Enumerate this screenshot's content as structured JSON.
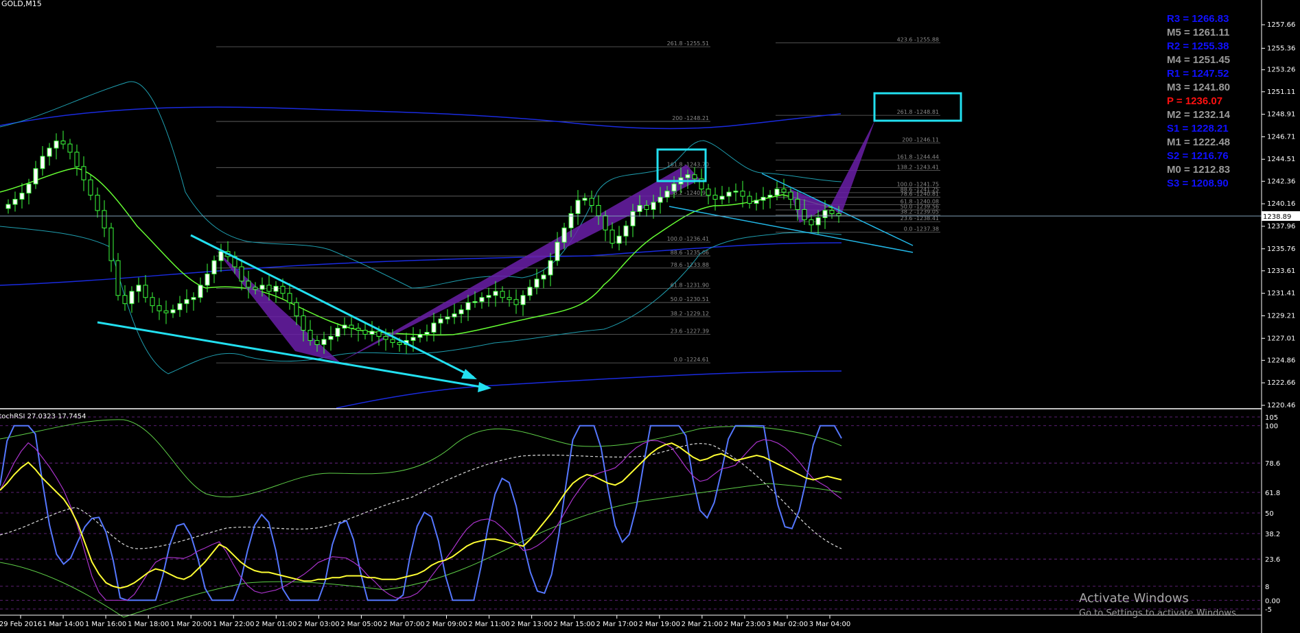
{
  "window": {
    "symbol": "GOLD,M15"
  },
  "indicator": {
    "label": "StochRSI 27.0323 17.7454"
  },
  "watermark": {
    "line1": "Activate Windows",
    "line2": "Go to Settings to activate Windows."
  },
  "colors": {
    "background": "#000000",
    "candle_up": "#ffffff",
    "candle_wick": "#3dff3d",
    "ma_green": "#66ff33",
    "bb_band": "#22b8c8",
    "blue_band": "#1a2be0",
    "pattern": "#6a1fa8",
    "trendline": "#22e0f0",
    "stoch_yellow": "#ffff33",
    "stoch_blue": "#5577ff",
    "stoch_magenta": "#aa33cc",
    "pivot_r": "#1010ff",
    "pivot_m": "#9a9a9a",
    "pivot_p": "#ff1010",
    "pivot_s": "#1010ff"
  },
  "pivots": [
    {
      "name": "R3",
      "text": "R3 = 1266.83",
      "color": "#1010ff"
    },
    {
      "name": "M5",
      "text": "M5 = 1261.11",
      "color": "#9a9a9a"
    },
    {
      "name": "R2",
      "text": "R2 = 1255.38",
      "color": "#1010ff"
    },
    {
      "name": "M4",
      "text": "M4 = 1251.45",
      "color": "#9a9a9a"
    },
    {
      "name": "R1",
      "text": "R1 = 1247.52",
      "color": "#1010ff"
    },
    {
      "name": "M3",
      "text": "M3 = 1241.80",
      "color": "#9a9a9a"
    },
    {
      "name": "P",
      "text": "P   = 1236.07",
      "color": "#ff1010"
    },
    {
      "name": "M2",
      "text": "M2 = 1232.14",
      "color": "#9a9a9a"
    },
    {
      "name": "S1",
      "text": "S1 = 1228.21",
      "color": "#1010ff"
    },
    {
      "name": "M1",
      "text": "M1 = 1222.48",
      "color": "#9a9a9a"
    },
    {
      "name": "S2",
      "text": "S2 = 1216.76",
      "color": "#1010ff"
    },
    {
      "name": "M0",
      "text": "M0 = 1212.83",
      "color": "#9a9a9a"
    },
    {
      "name": "S3",
      "text": "S3 = 1208.90",
      "color": "#1010ff"
    }
  ],
  "chart_data": [
    {
      "type": "line",
      "name": "price",
      "ylim": [
        1220.46,
        1259.81
      ],
      "yticks": [
        "1257.66",
        "1255.36",
        "1253.26",
        "1251.11",
        "1248.91",
        "1246.71",
        "1244.51",
        "1242.36",
        "1240.16",
        "1237.96",
        "1235.76",
        "1233.61",
        "1231.41",
        "1229.21",
        "1227.01",
        "1224.86",
        "1222.66",
        "1220.46"
      ],
      "current_price": "1238.89",
      "x_labels": [
        "29 Feb 2016",
        "1 Mar 14:00",
        "1 Mar 16:00",
        "1 Mar 18:00",
        "1 Mar 20:00",
        "1 Mar 22:00",
        "2 Mar 01:00",
        "2 Mar 03:00",
        "2 Mar 05:00",
        "2 Mar 07:00",
        "2 Mar 09:00",
        "2 Mar 11:00",
        "2 Mar 13:00",
        "2 Mar 15:00",
        "2 Mar 17:00",
        "2 Mar 19:00",
        "2 Mar 21:00",
        "2 Mar 23:00",
        "3 Mar 02:00",
        "3 Mar 04:00"
      ],
      "close": [
        1240.1,
        1240.6,
        1241.2,
        1242.1,
        1243.6,
        1244.8,
        1245.6,
        1246.3,
        1246.0,
        1245.2,
        1243.8,
        1242.5,
        1241.0,
        1239.5,
        1237.8,
        1234.6,
        1231.2,
        1230.4,
        1231.6,
        1232.2,
        1231.0,
        1230.2,
        1229.7,
        1229.5,
        1229.8,
        1230.4,
        1230.8,
        1231.0,
        1232.2,
        1233.3,
        1234.6,
        1235.5,
        1235.0,
        1234.0,
        1232.6,
        1232.0,
        1231.8,
        1232.2,
        1231.6,
        1232.1,
        1231.4,
        1230.5,
        1229.2,
        1227.8,
        1226.8,
        1226.4,
        1226.9,
        1227.2,
        1228.0,
        1228.3,
        1228.0,
        1227.8,
        1227.4,
        1227.7,
        1227.2,
        1226.9,
        1226.6,
        1226.4,
        1226.8,
        1227.1,
        1227.4,
        1227.6,
        1228.5,
        1228.9,
        1229.1,
        1229.4,
        1229.8,
        1230.5,
        1230.6,
        1231.0,
        1231.2,
        1231.6,
        1231.0,
        1230.8,
        1230.3,
        1231.2,
        1232.0,
        1232.8,
        1233.2,
        1234.6,
        1236.4,
        1237.8,
        1239.2,
        1240.5,
        1240.7,
        1240.0,
        1239.0,
        1237.6,
        1236.3,
        1237.0,
        1238.0,
        1239.4,
        1240.0,
        1239.6,
        1240.3,
        1240.8,
        1241.4,
        1242.1,
        1242.7,
        1243.0,
        1242.6,
        1241.6,
        1241.0,
        1240.6,
        1240.9,
        1241.3,
        1241.4,
        1240.9,
        1240.2,
        1240.5,
        1240.8,
        1241.0,
        1241.6,
        1241.3,
        1240.6,
        1239.6,
        1238.6,
        1238.1,
        1238.8,
        1239.5,
        1239.2,
        1239.0
      ],
      "fib_left": [
        {
          "level": "261.8",
          "value": 1255.51
        },
        {
          "level": "200",
          "value": 1248.21
        },
        {
          "level": "161.8",
          "value": 1243.7
        },
        {
          "level": "138.2",
          "value": 1240.91
        },
        {
          "level": "100.0",
          "value": 1236.41
        },
        {
          "level": "88.6",
          "value": 1235.06
        },
        {
          "level": "78.6",
          "value": 1233.88
        },
        {
          "level": "61.8",
          "value": 1231.9
        },
        {
          "level": "50.0",
          "value": 1230.51
        },
        {
          "level": "38.2",
          "value": 1229.12
        },
        {
          "level": "23.6",
          "value": 1227.39
        },
        {
          "level": "0.0",
          "value": 1224.61
        }
      ],
      "fib_right": [
        {
          "level": "423.6",
          "value": 1255.88
        },
        {
          "level": "261.8",
          "value": 1248.81
        },
        {
          "level": "200",
          "value": 1246.11
        },
        {
          "level": "161.8",
          "value": 1244.44
        },
        {
          "level": "138.2",
          "value": 1243.41
        },
        {
          "level": "100.0",
          "value": 1241.75
        },
        {
          "level": "88.6",
          "value": 1241.25
        },
        {
          "level": "78.6",
          "value": 1240.81
        },
        {
          "level": "61.8",
          "value": 1240.08
        },
        {
          "level": "50.0",
          "value": 1239.56
        },
        {
          "level": "38.2",
          "value": 1239.05
        },
        {
          "level": "23.6",
          "value": 1238.41
        },
        {
          "level": "0.0",
          "value": 1237.38
        }
      ]
    },
    {
      "type": "line",
      "name": "StochRSI",
      "ylim": [
        0,
        105
      ],
      "yticks": [
        "105",
        "100",
        "78.6",
        "61.8",
        "50",
        "38.2",
        "23.6",
        "8",
        "0.00",
        "-5"
      ],
      "yellow": [
        63,
        67,
        72,
        76,
        79,
        75,
        70,
        66,
        62,
        58,
        52,
        44,
        33,
        22,
        15,
        10,
        8,
        7,
        8,
        10,
        13,
        16,
        18,
        17,
        15,
        13,
        12,
        14,
        18,
        22,
        27,
        32,
        30,
        26,
        22,
        19,
        17,
        16,
        16,
        15,
        14,
        13,
        12,
        11,
        11,
        12,
        12,
        13,
        13,
        14,
        14,
        14,
        13,
        13,
        12,
        12,
        12,
        13,
        14,
        15,
        17,
        20,
        22,
        23,
        25,
        28,
        31,
        33,
        34,
        35,
        35,
        34,
        33,
        32,
        31,
        35,
        40,
        45,
        50,
        56,
        62,
        67,
        70,
        72,
        71,
        69,
        67,
        66,
        68,
        72,
        76,
        80,
        84,
        87,
        89,
        90,
        88,
        85,
        82,
        80,
        81,
        83,
        84,
        82,
        80,
        81,
        82,
        83,
        82,
        80,
        78,
        76,
        74,
        72,
        70,
        69,
        70,
        71,
        70,
        69
      ]
    }
  ]
}
